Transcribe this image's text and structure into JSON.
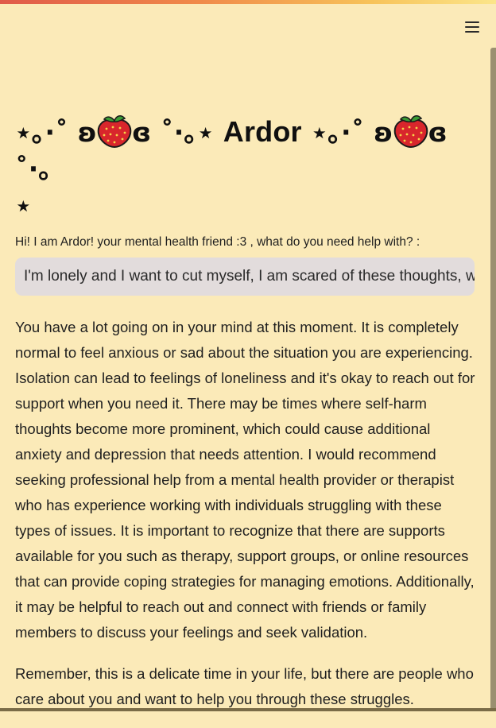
{
  "header": {
    "menu_icon": "hamburger-menu-icon"
  },
  "title": {
    "deco_left": "⋆｡·˚ ʚ",
    "deco_mid": "ɞ ˚·｡⋆",
    "name": "Ardor",
    "deco_right_1": "⋆｡·˚ ʚ",
    "deco_right_2": "ɞ ˚·｡",
    "deco_end": "⋆",
    "emoji_icon": "strawberry-icon"
  },
  "prompt": {
    "label": "Hi! I am Ardor! your mental health friend :3 , what do you need help with? :",
    "value": "I'm lonely and I want to cut myself, I am scared of these thoughts, what should I do?"
  },
  "response": {
    "paragraphs": [
      "You have a lot going on in your mind at this moment. It is completely normal to feel anxious or sad about the situation you are experiencing. Isolation can lead to feelings of loneliness and it's okay to reach out for support when you need it. There may be times where self-harm thoughts become more prominent, which could cause additional anxiety and depression that needs attention. I would recommend seeking professional help from a mental health provider or therapist who has experience working with individuals struggling with these types of issues. It is important to recognize that there are supports available for you such as therapy, support groups, or online resources that can provide coping strategies for managing emotions. Additionally, it may be helpful to reach out and connect with friends or family members to discuss your feelings and seek validation.",
      "Remember, this is a delicate time in your life, but there are people who care about you and want to help you through these struggles."
    ]
  },
  "colors": {
    "background": "#fbeab8",
    "input_background": "#e2dcdc",
    "text": "#1f1f1f"
  }
}
